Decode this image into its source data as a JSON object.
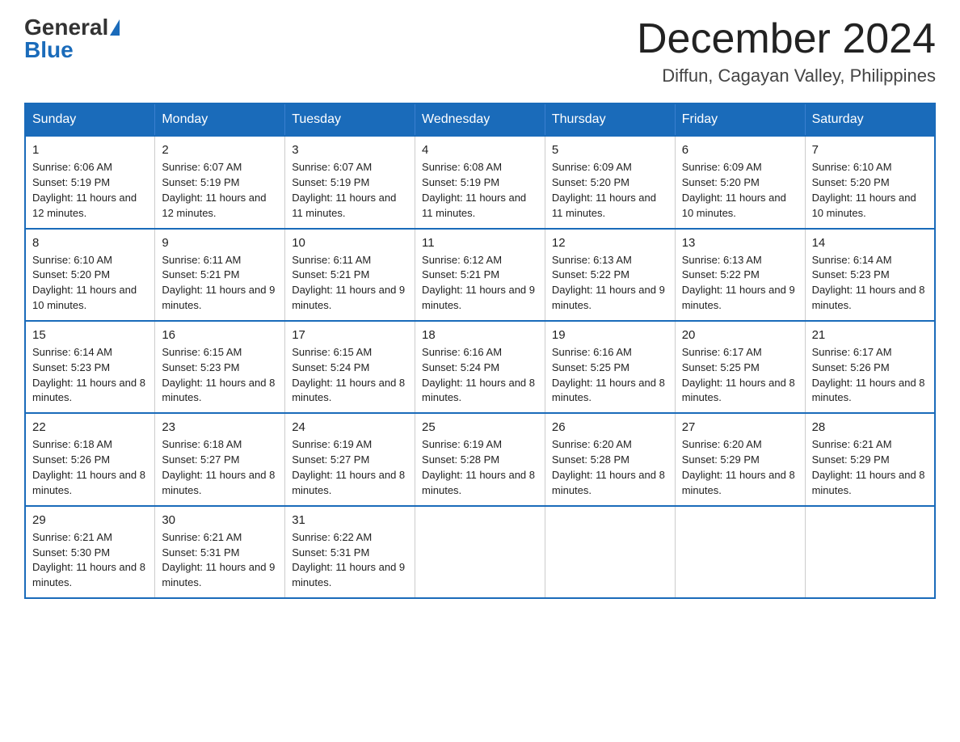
{
  "header": {
    "logo_general": "General",
    "logo_blue": "Blue",
    "month_title": "December 2024",
    "location": "Diffun, Cagayan Valley, Philippines"
  },
  "weekdays": [
    "Sunday",
    "Monday",
    "Tuesday",
    "Wednesday",
    "Thursday",
    "Friday",
    "Saturday"
  ],
  "weeks": [
    [
      {
        "day": "1",
        "sunrise": "6:06 AM",
        "sunset": "5:19 PM",
        "daylight": "11 hours and 12 minutes."
      },
      {
        "day": "2",
        "sunrise": "6:07 AM",
        "sunset": "5:19 PM",
        "daylight": "11 hours and 12 minutes."
      },
      {
        "day": "3",
        "sunrise": "6:07 AM",
        "sunset": "5:19 PM",
        "daylight": "11 hours and 11 minutes."
      },
      {
        "day": "4",
        "sunrise": "6:08 AM",
        "sunset": "5:19 PM",
        "daylight": "11 hours and 11 minutes."
      },
      {
        "day": "5",
        "sunrise": "6:09 AM",
        "sunset": "5:20 PM",
        "daylight": "11 hours and 11 minutes."
      },
      {
        "day": "6",
        "sunrise": "6:09 AM",
        "sunset": "5:20 PM",
        "daylight": "11 hours and 10 minutes."
      },
      {
        "day": "7",
        "sunrise": "6:10 AM",
        "sunset": "5:20 PM",
        "daylight": "11 hours and 10 minutes."
      }
    ],
    [
      {
        "day": "8",
        "sunrise": "6:10 AM",
        "sunset": "5:20 PM",
        "daylight": "11 hours and 10 minutes."
      },
      {
        "day": "9",
        "sunrise": "6:11 AM",
        "sunset": "5:21 PM",
        "daylight": "11 hours and 9 minutes."
      },
      {
        "day": "10",
        "sunrise": "6:11 AM",
        "sunset": "5:21 PM",
        "daylight": "11 hours and 9 minutes."
      },
      {
        "day": "11",
        "sunrise": "6:12 AM",
        "sunset": "5:21 PM",
        "daylight": "11 hours and 9 minutes."
      },
      {
        "day": "12",
        "sunrise": "6:13 AM",
        "sunset": "5:22 PM",
        "daylight": "11 hours and 9 minutes."
      },
      {
        "day": "13",
        "sunrise": "6:13 AM",
        "sunset": "5:22 PM",
        "daylight": "11 hours and 9 minutes."
      },
      {
        "day": "14",
        "sunrise": "6:14 AM",
        "sunset": "5:23 PM",
        "daylight": "11 hours and 8 minutes."
      }
    ],
    [
      {
        "day": "15",
        "sunrise": "6:14 AM",
        "sunset": "5:23 PM",
        "daylight": "11 hours and 8 minutes."
      },
      {
        "day": "16",
        "sunrise": "6:15 AM",
        "sunset": "5:23 PM",
        "daylight": "11 hours and 8 minutes."
      },
      {
        "day": "17",
        "sunrise": "6:15 AM",
        "sunset": "5:24 PM",
        "daylight": "11 hours and 8 minutes."
      },
      {
        "day": "18",
        "sunrise": "6:16 AM",
        "sunset": "5:24 PM",
        "daylight": "11 hours and 8 minutes."
      },
      {
        "day": "19",
        "sunrise": "6:16 AM",
        "sunset": "5:25 PM",
        "daylight": "11 hours and 8 minutes."
      },
      {
        "day": "20",
        "sunrise": "6:17 AM",
        "sunset": "5:25 PM",
        "daylight": "11 hours and 8 minutes."
      },
      {
        "day": "21",
        "sunrise": "6:17 AM",
        "sunset": "5:26 PM",
        "daylight": "11 hours and 8 minutes."
      }
    ],
    [
      {
        "day": "22",
        "sunrise": "6:18 AM",
        "sunset": "5:26 PM",
        "daylight": "11 hours and 8 minutes."
      },
      {
        "day": "23",
        "sunrise": "6:18 AM",
        "sunset": "5:27 PM",
        "daylight": "11 hours and 8 minutes."
      },
      {
        "day": "24",
        "sunrise": "6:19 AM",
        "sunset": "5:27 PM",
        "daylight": "11 hours and 8 minutes."
      },
      {
        "day": "25",
        "sunrise": "6:19 AM",
        "sunset": "5:28 PM",
        "daylight": "11 hours and 8 minutes."
      },
      {
        "day": "26",
        "sunrise": "6:20 AM",
        "sunset": "5:28 PM",
        "daylight": "11 hours and 8 minutes."
      },
      {
        "day": "27",
        "sunrise": "6:20 AM",
        "sunset": "5:29 PM",
        "daylight": "11 hours and 8 minutes."
      },
      {
        "day": "28",
        "sunrise": "6:21 AM",
        "sunset": "5:29 PM",
        "daylight": "11 hours and 8 minutes."
      }
    ],
    [
      {
        "day": "29",
        "sunrise": "6:21 AM",
        "sunset": "5:30 PM",
        "daylight": "11 hours and 8 minutes."
      },
      {
        "day": "30",
        "sunrise": "6:21 AM",
        "sunset": "5:31 PM",
        "daylight": "11 hours and 9 minutes."
      },
      {
        "day": "31",
        "sunrise": "6:22 AM",
        "sunset": "5:31 PM",
        "daylight": "11 hours and 9 minutes."
      },
      null,
      null,
      null,
      null
    ]
  ]
}
